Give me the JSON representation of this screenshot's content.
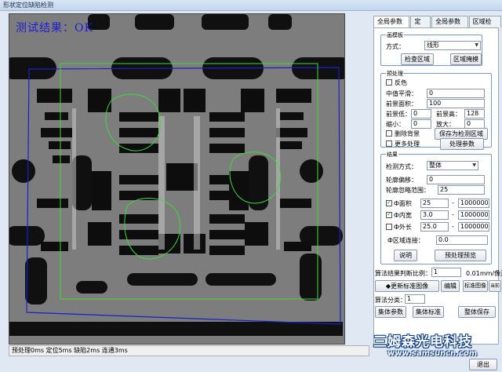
{
  "window": {
    "title": "形状定位缺陷检测"
  },
  "viewer": {
    "result_text": "测试结果：OK"
  },
  "status": {
    "text": "预处理0ms 定位5ms 缺陷2ms 连通3ms"
  },
  "tabs": [
    {
      "label": "全局参数1",
      "active": true
    },
    {
      "label": "定位",
      "active": false
    },
    {
      "label": "全局参数2",
      "active": false
    },
    {
      "label": "区域检测",
      "active": false
    }
  ],
  "template_group": {
    "title": "画模板",
    "method_label": "方式：",
    "method_value": "线形",
    "check_region_btn": "检查区域",
    "region_mask_btn": "区域掩模"
  },
  "preprocess_group": {
    "title": "预处理",
    "invert_label": "反色",
    "median_label": "中值平滑：",
    "median_value": "0",
    "fg_area_label": "前景面积：",
    "fg_area_value": "100",
    "fg_low_label": "前景低：",
    "fg_low_value": "0",
    "fg_high_label": "前景高：",
    "fg_high_value": "128",
    "shrink_label": "缩小：",
    "shrink_value": "0",
    "enlarge_label": "放大：",
    "enlarge_value": "0",
    "remove_bg_label": "删除背景",
    "save_region_btn": "保存为检测区域",
    "more_process_label": "更多处理",
    "process_params_btn": "处理参数"
  },
  "result_group": {
    "title": "结果",
    "detect_mode_label": "检测方式：",
    "detect_mode_value": "整体",
    "contour_offset_label": "轮廓偏移：",
    "contour_offset_value": "0",
    "contour_ignore_label": "轮廓忽略范围：",
    "contour_ignore_value": "25",
    "area_label": "Ф面积",
    "area_min": "25",
    "area_max": "1000000",
    "inner_width_label": "Ф内宽",
    "inner_width_min": "3.0",
    "inner_width_max": "1000000",
    "outer_length_label": "Ф外长",
    "outer_length_min": "25.0",
    "outer_length_max": "1000000",
    "region_connect_label": "Ф区域连接：",
    "region_connect_value": "0.0",
    "range_sep": "-",
    "explain_btn": "说明",
    "preview_btn": "预处理预览"
  },
  "bottom": {
    "scale_label": "算法结果判断比例：",
    "scale_value": "1",
    "scale_unit": "0.01mm/像素",
    "update_std_btn": "◆更新标准图像",
    "edit_btn": "编辑",
    "std_image_btn": "标准图像",
    "current_image_btn": "当前图像",
    "algo_split_label": "算法分类：",
    "algo_split_value": "1",
    "collect_params_btn": "集体参数",
    "collect_std_btn": "集体标准",
    "save_all_btn": "整体保存",
    "exit_btn": "退出"
  },
  "watermark": {
    "cn": "三姆森光电科技",
    "en": "www.samsuncn.com"
  },
  "colors": {
    "frame_blue": "#1a20c8",
    "contour_green": "#3bdc3b",
    "result_text": "#1b1bd8"
  }
}
